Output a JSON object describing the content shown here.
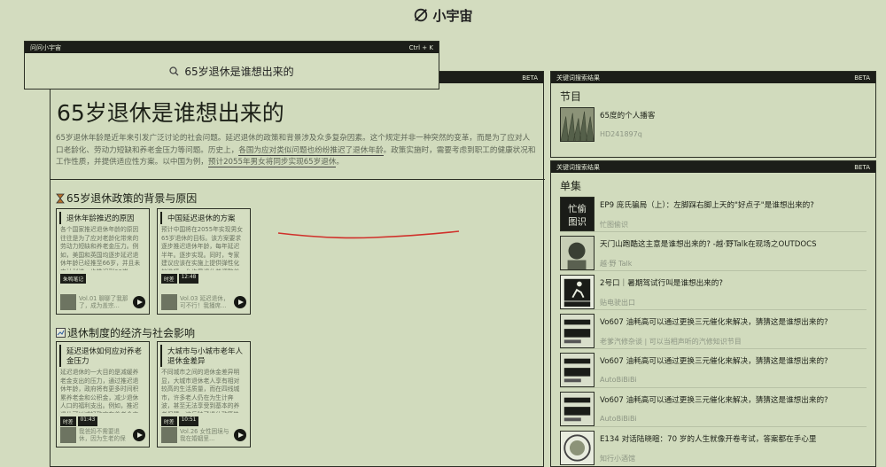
{
  "app": {
    "brand": "小宇宙"
  },
  "search": {
    "label": "问问小宇宙",
    "shortcut": "Ctrl + K",
    "query": "65岁退休是谁想出来的"
  },
  "main": {
    "badge": "BETA",
    "title": "65岁退休是谁想出来的",
    "intro_parts": [
      "65岁退休年龄是近年来引发广泛讨论的社会问题。延迟退休的政策和背景涉及众多复杂因素。这个规定并非一种突然的变革，而是为了应对人口老龄化、劳动力短缺和养老金压力等问题。历史上，",
      "各国为应对类似问题也纷纷推迟了退休年龄",
      "。政策实施时，需要考虑到职工的健康状况和工作性质，并提供适应性方案。以中国为例，",
      "预计2055年男女将同步实现65岁退休",
      "。"
    ],
    "sections": [
      {
        "title": "65岁退休政策的背景与原因",
        "cards": [
          {
            "title": "退休年龄推迟的原因",
            "body": "各个国家推迟退休年龄的原因往往是为了应对老龄化带来的劳动力短缺和养老金压力。例如，美国和英国均逐步延迟退休年龄已经推至66岁，并且未来计划进一步推迟到68岁",
            "tags": [
              "朱鸭笔记"
            ],
            "foot": "Vol.01 聊聊了我那了，成为盖宗..."
          },
          {
            "title": "中国延迟退休的方案",
            "body": "预计中国将在2055年实现男女65岁退休的目标。该方案要求逐步推迟退休年龄，每年延迟半年。逐步实现。同时，专家建议应该在实施上提供弹性化的选择，允许早退休并调整养老金的待遇",
            "tags": [
              "时差",
              "12:48"
            ],
            "foot": "Vol.03 延迟退休，可不行！我播席..."
          }
        ]
      },
      {
        "title": "退休制度的经济与社会影响",
        "cards": [
          {
            "title": "延迟退休如何应对养老金压力",
            "body": "延迟退休的一大目的是减缓养老金支出的压力，通过推迟退休年龄，政府将有更多时间积累养老金和公积金，减少退休人口的福利支出。例如，推迟退休可以减轻政府在养老金方面的负担",
            "tags": [
              "时差",
              "01:43"
            ],
            "foot": "我爸妈不需要退休，因为生老的保障..."
          },
          {
            "title": "大城市与小城市老年人退休金差异",
            "body": "不同城市之间的退休金差异明显，大城市退休老人享有相对较高的生活质量，而在四线城市，许多老人仍在为生计奔波，甚至无法享受到基本的养老保障。这反映了退休政策执行中的地域差异",
            "tags": [
              "时差",
              "10:51"
            ],
            "foot": "Vol.26 女性困境与我在婚姻里..."
          }
        ]
      }
    ]
  },
  "right1": {
    "header": "关键词搜索结果",
    "badge": "BETA",
    "section": "节目",
    "items": [
      {
        "title": "65度的个人播客",
        "sub": "HD241897q"
      }
    ]
  },
  "right2": {
    "header": "关键词搜索结果",
    "badge": "BETA",
    "section": "单集",
    "items": [
      {
        "title": "EP9 庞氏骗局（上）：左脚踩右脚上天的\"好点子\"是谁想出来的?",
        "sub": "忙图偷识"
      },
      {
        "title": "天门山跑酷这主意是谁想出来的? -越·野Talk在现场之OUTDOCS",
        "sub": "越·野 Talk"
      },
      {
        "title": "2号口｜暑期驾试行叫是谁想出来的?",
        "sub": "贴电驶出口"
      },
      {
        "title": "Vo607 油耗高可以通过更换三元催化来解决，猜猜这是谁想出来的?",
        "sub": "老爹汽修杂谈 | 可以当相声听的汽修知识节目"
      },
      {
        "title": "Vo607 油耗高可以通过更换三元催化来解决，猜猜这是谁想出来的?",
        "sub": "AutoBiBiBi"
      },
      {
        "title": "Vo607 油耗高可以通过更换三元催化来解决，猜猜这是谁想出来的?",
        "sub": "AutoBiBiBi"
      },
      {
        "title": "E134 对话陆晓暄：70 岁的人生就像开卷考试，答案都在手心里",
        "sub": "知行小酒馆"
      }
    ]
  },
  "colors": {
    "bg": "#d3dcbf",
    "header_bar": "#1c1e19",
    "underline": "#d0302a"
  }
}
